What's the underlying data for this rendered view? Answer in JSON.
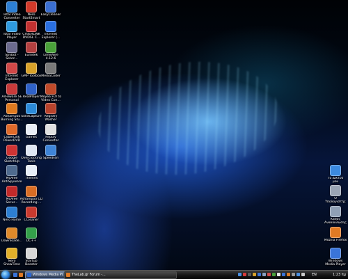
{
  "desktop_icons": [
    {
      "id": "total-video-converter",
      "label": "Total Video\nConverter",
      "color": "#2d7fd3"
    },
    {
      "id": "nero-startsmart",
      "label": "Nero\nStartSmart",
      "color": "#d23a2a"
    },
    {
      "id": "easycleaner",
      "label": "EasyCleaner",
      "color": "#3b6fd1"
    },
    {
      "id": "total-video-player",
      "label": "Total Video\nPlayer",
      "color": "#2f9be0"
    },
    {
      "id": "cyberlink-dvd-suite",
      "label": "CYBERLINK\nDVDSL C...",
      "color": "#c23131"
    },
    {
      "id": "internet-explorer-2",
      "label": "Internet\nExplorer (...",
      "color": "#2a6fe0"
    },
    {
      "id": "spybot",
      "label": "Spybot -\nSearc...",
      "color": "#6b6b8f"
    },
    {
      "id": "eureka",
      "label": "Eurodek",
      "color": "#b34040"
    },
    {
      "id": "limewire",
      "label": "LimeWire\n4.12.6",
      "color": "#4aa13a"
    },
    {
      "id": "internet-explorer",
      "label": "Internet\nExplorer",
      "color": "#d04848"
    },
    {
      "id": "gmp-toolbox",
      "label": "GMP Toolbox",
      "color": "#d8a22a"
    },
    {
      "id": "mediacoder",
      "label": "MediaCoder",
      "color": "#7a7a7a"
    },
    {
      "id": "ad-aware",
      "label": "Ad-Aware SE\nPersonal",
      "color": "#c83a3a"
    },
    {
      "id": "realplayer",
      "label": "RealPlayer",
      "color": "#2f62c9"
    },
    {
      "id": "moyea-flv",
      "label": "Moyea FLV to\nVideo Con...",
      "color": "#c04a2a"
    },
    {
      "id": "ashampoo-burning",
      "label": "Ashampoo\nBurning Stu...",
      "color": "#e07a1f"
    },
    {
      "id": "solidcapture",
      "label": "SolidCapture",
      "color": "#2c8ad8"
    },
    {
      "id": "registry-washer",
      "label": "Registry\nWasher",
      "color": "#b9432c"
    },
    {
      "id": "cyberlink-powerdvd",
      "label": "CyberLink\nPowerDVD",
      "color": "#e06a2a"
    },
    {
      "id": "games",
      "label": "Games",
      "color": "#e9eef6"
    },
    {
      "id": "replay-converter",
      "label": "Replay\nConverter",
      "color": "#e0e0e0"
    },
    {
      "id": "google-sketchup",
      "label": "Google\nSketchUp",
      "color": "#cf3434"
    },
    {
      "id": "overclocking-tools",
      "label": "Overclocking\nTools",
      "color": "#dfe7f3"
    },
    {
      "id": "speedfan",
      "label": "SpeedFan",
      "color": "#3f84d7"
    },
    {
      "id": "mcafee-antispyware",
      "label": "McAfee\nAntiSpyware",
      "color": "#4f6b8f"
    },
    {
      "id": "themes",
      "label": "Themes",
      "color": "#e6edf7"
    },
    {
      "id": "mcafee-secure",
      "label": "McAfee\nSecur...",
      "color": "#c32a2a"
    },
    {
      "id": "ashampoo-cd",
      "label": "Ashampoo CD\nRecording ...",
      "color": "#d86d25"
    },
    {
      "id": "nero-home",
      "label": "Nero Home",
      "color": "#2d7fd3"
    },
    {
      "id": "ccleaner",
      "label": "CCleaner",
      "color": "#c93a2f"
    },
    {
      "id": "downloads",
      "label": "Downloade...",
      "color": "#e08a2a"
    },
    {
      "id": "dcpp",
      "label": "DC++",
      "color": "#34a04a"
    },
    {
      "id": "nero-showtime",
      "label": "Nero\nShowTime",
      "color": "#e3b02a"
    },
    {
      "id": "startup-booster",
      "label": "Startup\nBooster",
      "color": "#d6d6d6"
    },
    {
      "id": "network",
      "label": "Το Δίκτυό\nμου",
      "color": "#3c8ae0"
    },
    {
      "id": "my-computer",
      "label": "Ο Υπολογιστής\nμου",
      "color": "#9aa5b5"
    },
    {
      "id": "recycle-bin",
      "label": "Κάδος\nΑνακύκλωσης",
      "color": "#8fa0b5"
    },
    {
      "id": "mozilla-firefox",
      "label": "Mozilla Firefox",
      "color": "#e07a24"
    },
    {
      "id": "windows-media-player",
      "label": "Windows\nMedia Player",
      "color": "#3a74d8"
    }
  ],
  "taskbar": {
    "start_label": "Start",
    "tasks": [
      {
        "label": "Windows Media Pl...",
        "color": "#2a66d0",
        "active": true
      },
      {
        "label": "TheLab.gr Forum -...",
        "color": "#e07a24",
        "active": false
      }
    ],
    "lang": "EN",
    "clock": "1:23 πμ"
  },
  "colors": {
    "accent": "#2b7fd8",
    "taskbar_bg": "#151515"
  }
}
